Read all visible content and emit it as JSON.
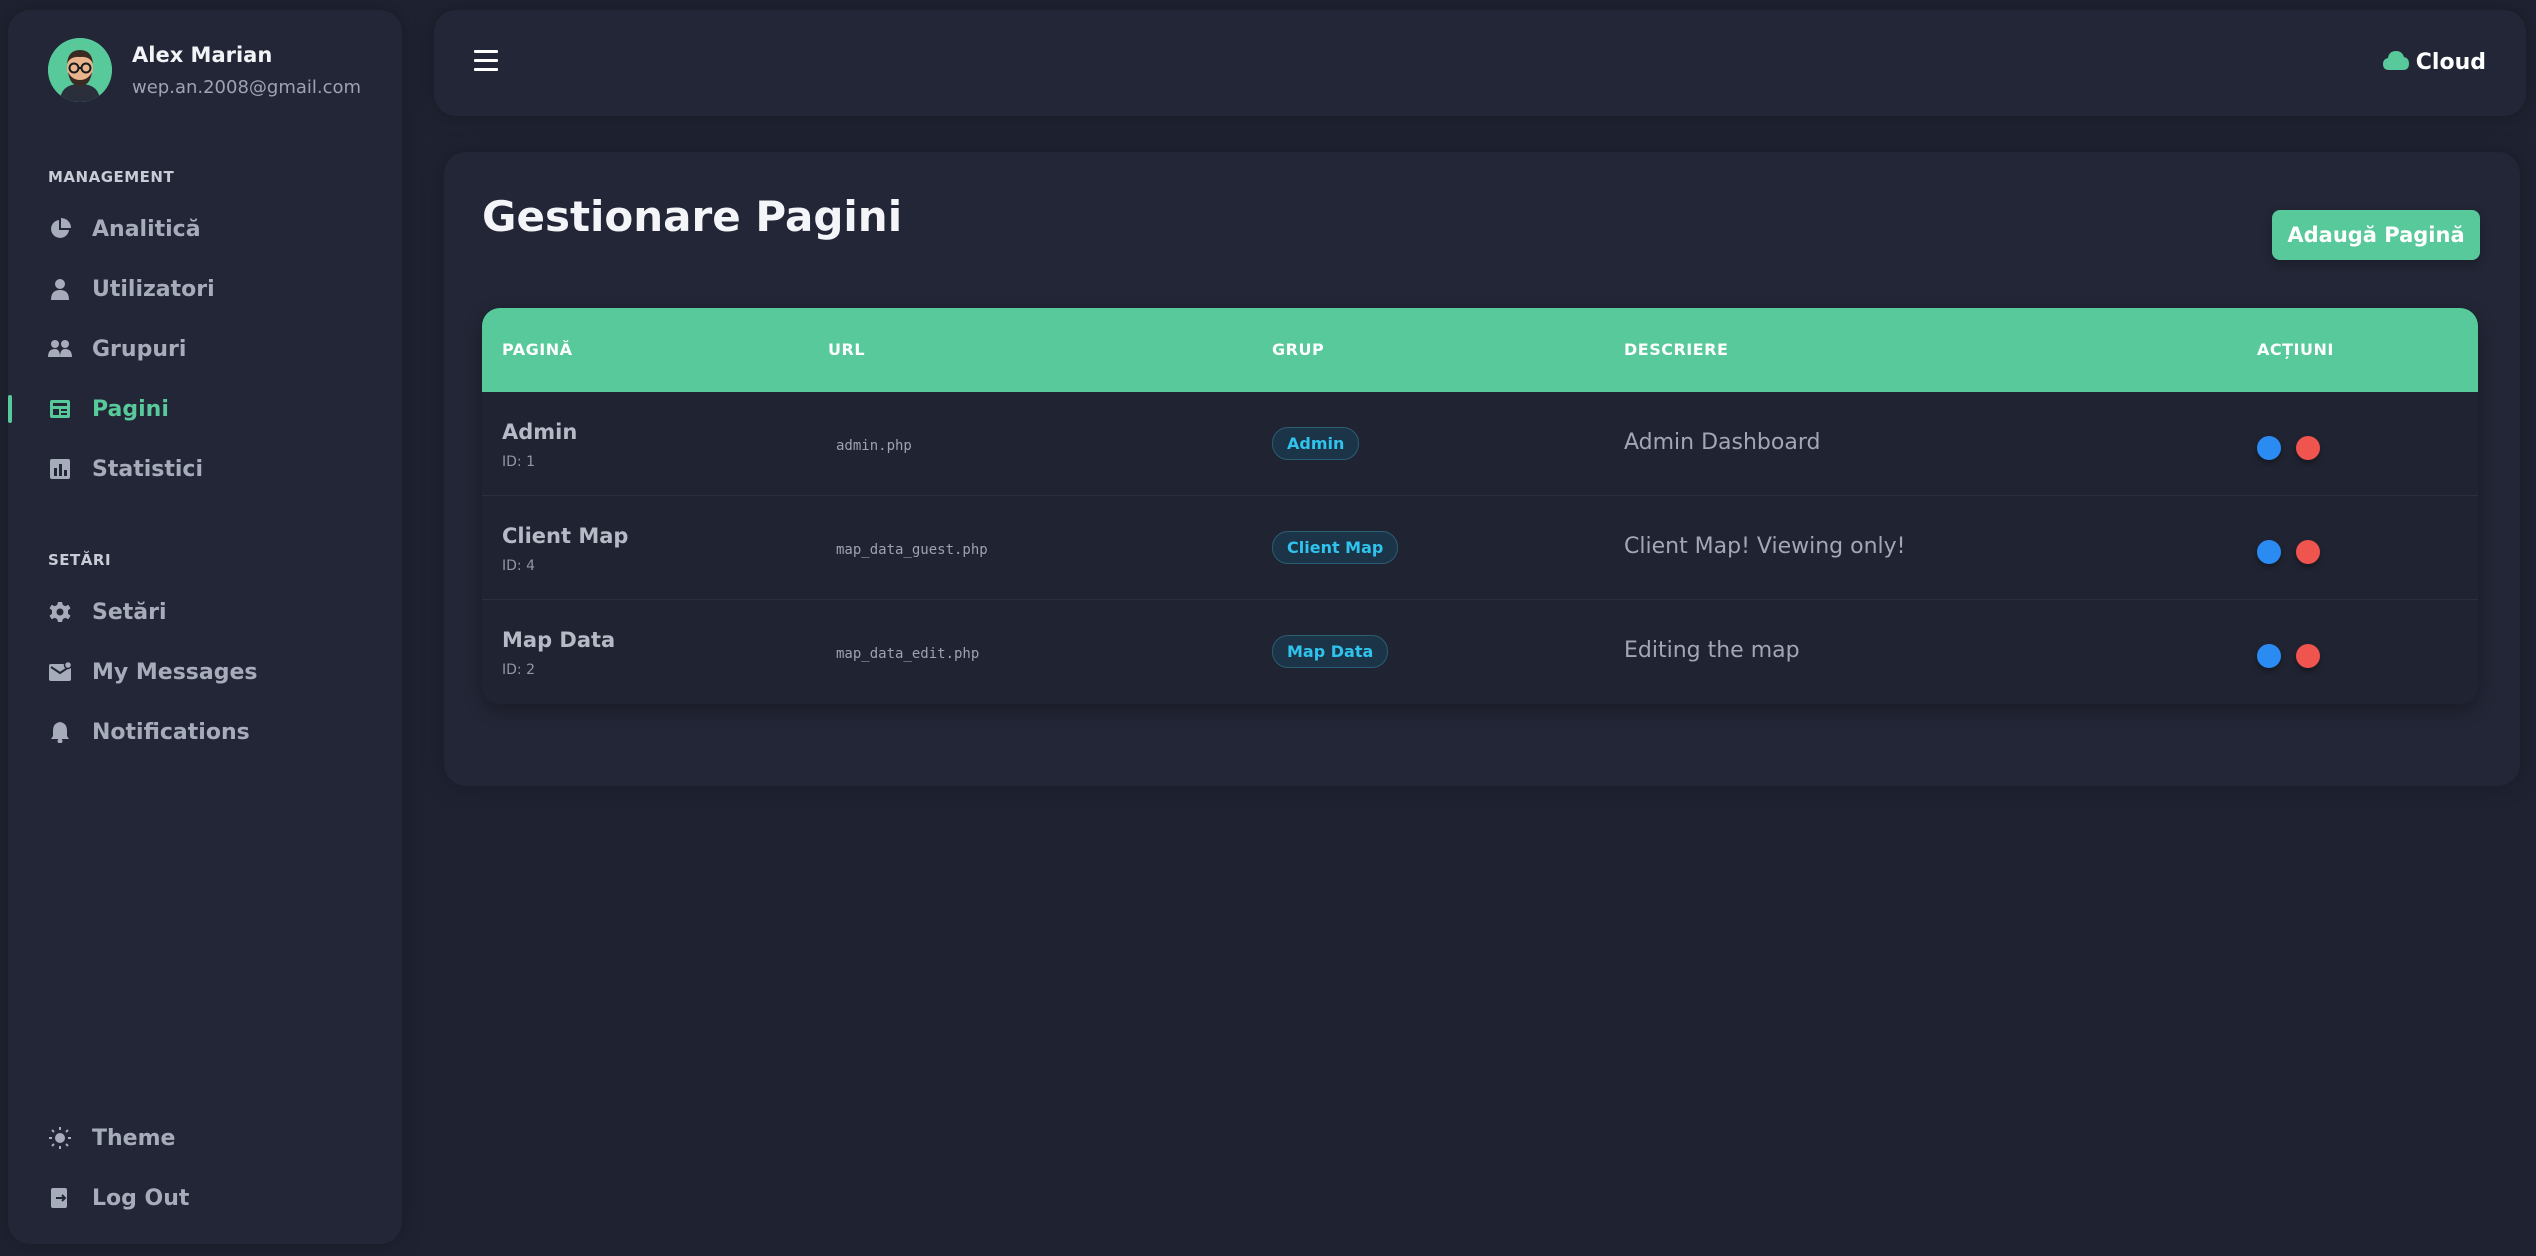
{
  "user": {
    "name": "Alex Marian",
    "email": "wep.an.2008@gmail.com"
  },
  "sidebar": {
    "management_title": "MANAGEMENT",
    "settings_title": "SETĂRI",
    "items": [
      {
        "label": "Analitică",
        "icon": "pie-chart-icon"
      },
      {
        "label": "Utilizatori",
        "icon": "user-icon"
      },
      {
        "label": "Grupuri",
        "icon": "users-icon"
      },
      {
        "label": "Pagini",
        "icon": "page-icon",
        "active": true
      },
      {
        "label": "Statistici",
        "icon": "bar-chart-icon"
      }
    ],
    "settings_items": [
      {
        "label": "Setări",
        "icon": "gear-icon"
      },
      {
        "label": "My Messages",
        "icon": "mail-icon"
      },
      {
        "label": "Notifications",
        "icon": "bell-icon"
      }
    ],
    "bottom_items": [
      {
        "label": "Theme",
        "icon": "sun-icon"
      },
      {
        "label": "Log Out",
        "icon": "logout-icon"
      }
    ]
  },
  "header": {
    "brand": "Cloud"
  },
  "main": {
    "title": "Gestionare Pagini",
    "add_button": "Adaugă Pagină",
    "columns": [
      "PAGINĂ",
      "URL",
      "GRUP",
      "DESCRIERE",
      "ACȚIUNI"
    ],
    "rows": [
      {
        "name": "Admin",
        "id": "ID: 1",
        "url": "admin.php",
        "group": "Admin",
        "description": "Admin Dashboard"
      },
      {
        "name": "Client Map",
        "id": "ID: 4",
        "url": "map_data_guest.php",
        "group": "Client Map",
        "description": "Client Map! Viewing only!"
      },
      {
        "name": "Map Data",
        "id": "ID: 2",
        "url": "map_data_edit.php",
        "group": "Map Data",
        "description": "Editing the map"
      }
    ]
  },
  "colors": {
    "accent": "#57c99a",
    "background": "#1f2231",
    "panel": "#232636",
    "edit_action": "#2a8cf2",
    "delete_action": "#f0544f",
    "badge_text": "#2fc3ee"
  }
}
